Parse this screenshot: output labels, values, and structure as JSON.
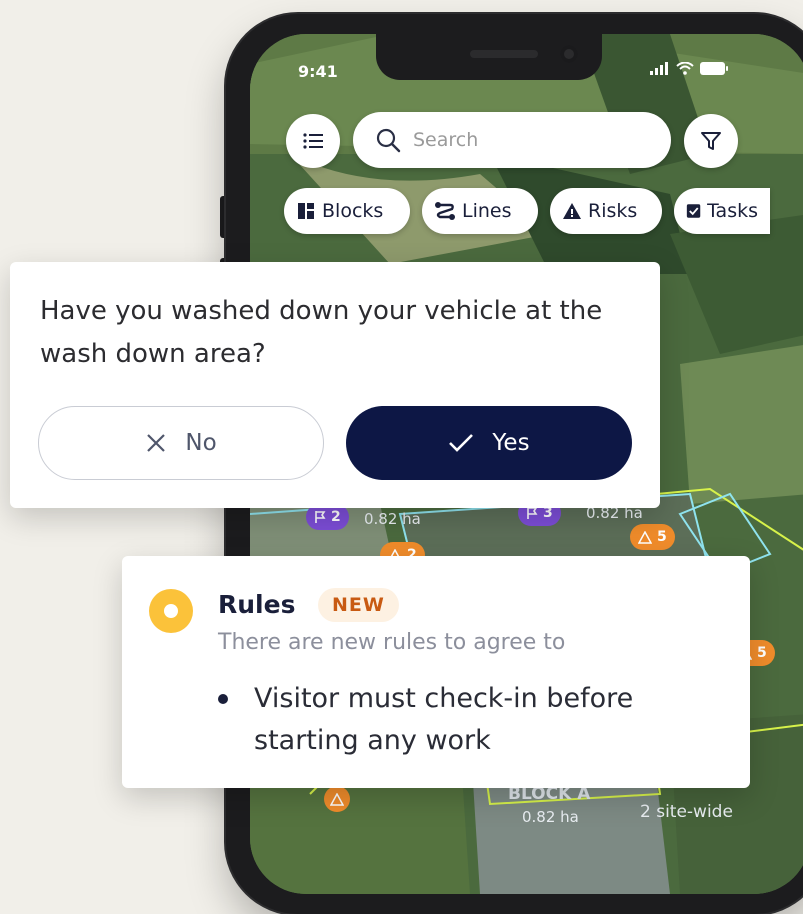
{
  "status_bar": {
    "time": "9:41"
  },
  "search": {
    "placeholder": "Search"
  },
  "chips": [
    {
      "label": "Blocks",
      "icon": "blocks-icon"
    },
    {
      "label": "Lines",
      "icon": "lines-icon"
    },
    {
      "label": "Risks",
      "icon": "risk-warning-icon"
    },
    {
      "label": "Tasks",
      "icon": "task-checkbox-icon"
    }
  ],
  "dialog": {
    "question": "Have you washed down your vehicle at the wash down area?",
    "no_label": "No",
    "yes_label": "Yes"
  },
  "map": {
    "block_a_label": "BLOCK A",
    "block_a_area": "0.82 ha",
    "block_area_left": "0.82 ha",
    "block_area_mid": "0.82 ha",
    "flag_count_left": "2",
    "flag_count_mid": "3",
    "risk_count_a": "2",
    "risk_count_b": "5",
    "risk_count_c": "5",
    "site_wide": "2 site-wide"
  },
  "rules": {
    "title": "Rules",
    "badge": "NEW",
    "subtitle": "There are new rules to agree to",
    "items": [
      "Visitor must check-in before starting any work"
    ]
  },
  "colors": {
    "primary": "#0d1745",
    "accent_orange": "#f08c2b",
    "rules_yellow": "#fbc23a",
    "badge_text": "#c85a12",
    "badge_bg": "#fdf1e2"
  }
}
